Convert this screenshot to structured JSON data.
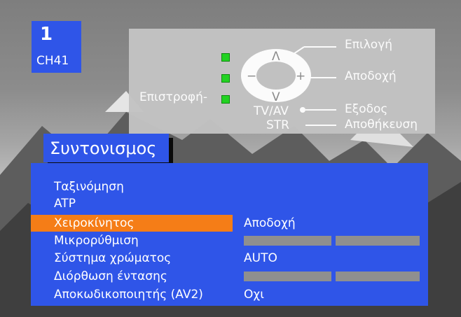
{
  "channel": {
    "number": "1",
    "name": "CH41"
  },
  "help": {
    "select_label": "Επιλογή",
    "accept_label": "Αποδοχή",
    "back_label": "Επιστροφή-",
    "tvav_label": "TV/AV",
    "exit_label": "Εξοδος",
    "str_label": "STR",
    "store_label": "Αποθήκευση",
    "minus_symbol": "−",
    "plus_symbol": "+",
    "up_symbol": "Λ",
    "down_symbol": "V"
  },
  "menu": {
    "title": "Συντονισμος",
    "items": [
      {
        "label": "Ταξινόμηση"
      },
      {
        "label": "ATP"
      },
      {
        "label": "Χειροκίνητος",
        "value": "Αποδοχή",
        "selected": true
      },
      {
        "label": "Μικρορύθμιση"
      },
      {
        "label": "Σύστημα χρώματος",
        "value": "AUTO"
      },
      {
        "label": "Διόρθωση έντασης"
      },
      {
        "label": "Αποκωδικοποιητής (AV2)",
        "value": "Οχι"
      }
    ]
  },
  "colors": {
    "menu_blue": "#2f55e8",
    "highlight_orange": "#f57d17",
    "panel_gray": "#c3c3c3",
    "led_green": "#1fd51f"
  }
}
